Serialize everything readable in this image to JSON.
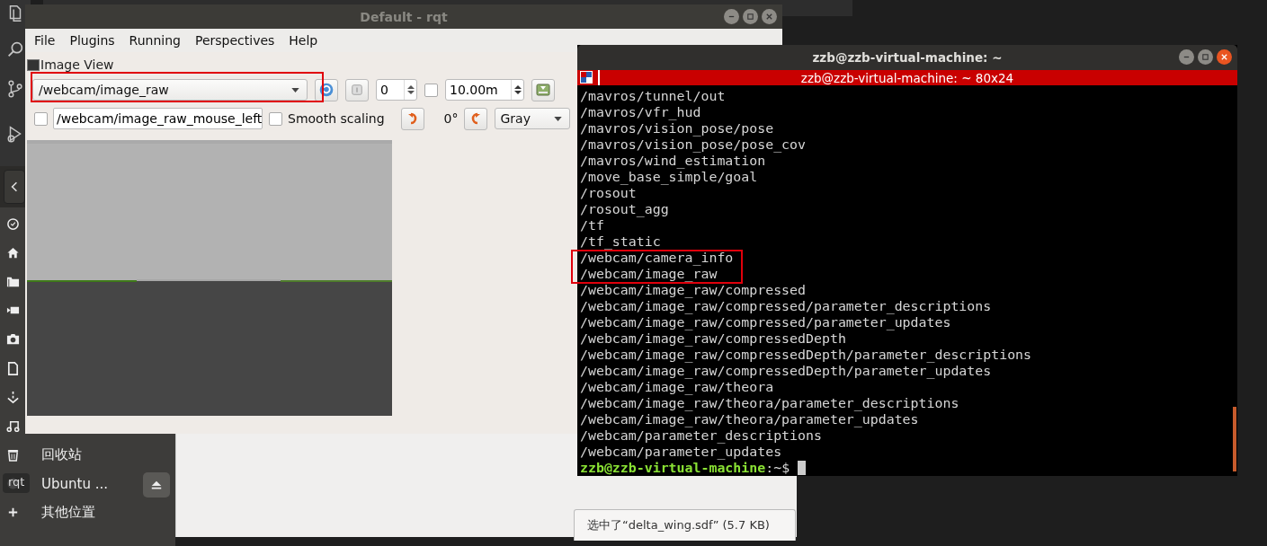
{
  "rqt": {
    "title": "Default - rqt",
    "menus": [
      {
        "label": "File"
      },
      {
        "label": "Plugins"
      },
      {
        "label": "Running"
      },
      {
        "label": "Perspectives"
      },
      {
        "label": "Help"
      }
    ],
    "plugin_title": "Image View",
    "topic": "/webcam/image_raw",
    "spin_value": "0",
    "timeout_checkbox": {
      "checked": false
    },
    "timeout_value": "10.00m",
    "mouse_checkbox": {
      "checked": false
    },
    "mouse_topic": "/webcam/image_raw_mouse_left",
    "smooth_scaling": {
      "label": "Smooth scaling",
      "checked": false
    },
    "rotation": "0°",
    "color_scheme": "Gray"
  },
  "terminal": {
    "title": "zzb@zzb-virtual-machine: ~",
    "tab_title": "zzb@zzb-virtual-machine: ~ 80x24",
    "lines": [
      "/mavros/tunnel/out",
      "/mavros/vfr_hud",
      "/mavros/vision_pose/pose",
      "/mavros/vision_pose/pose_cov",
      "/mavros/wind_estimation",
      "/move_base_simple/goal",
      "/rosout",
      "/rosout_agg",
      "/tf",
      "/tf_static",
      "/webcam/camera_info",
      "/webcam/image_raw",
      "/webcam/image_raw/compressed",
      "/webcam/image_raw/compressed/parameter_descriptions",
      "/webcam/image_raw/compressed/parameter_updates",
      "/webcam/image_raw/compressedDepth",
      "/webcam/image_raw/compressedDepth/parameter_descriptions",
      "/webcam/image_raw/compressedDepth/parameter_updates",
      "/webcam/image_raw/theora",
      "/webcam/image_raw/theora/parameter_descriptions",
      "/webcam/image_raw/theora/parameter_updates",
      "/webcam/parameter_descriptions",
      "/webcam/parameter_updates"
    ],
    "prompt_user": "zzb@zzb-virtual-machine",
    "prompt_suffix": ":~$"
  },
  "files": {
    "places": [
      {
        "label": "回收站",
        "kind": "trash"
      },
      {
        "label": "Ubuntu ...",
        "kind": "drive"
      },
      {
        "label": "其他位置",
        "kind": "other"
      }
    ],
    "status": "选中了“delta_wing.sdf”  (5.7 KB)"
  },
  "dock_tooltip": "rqt"
}
